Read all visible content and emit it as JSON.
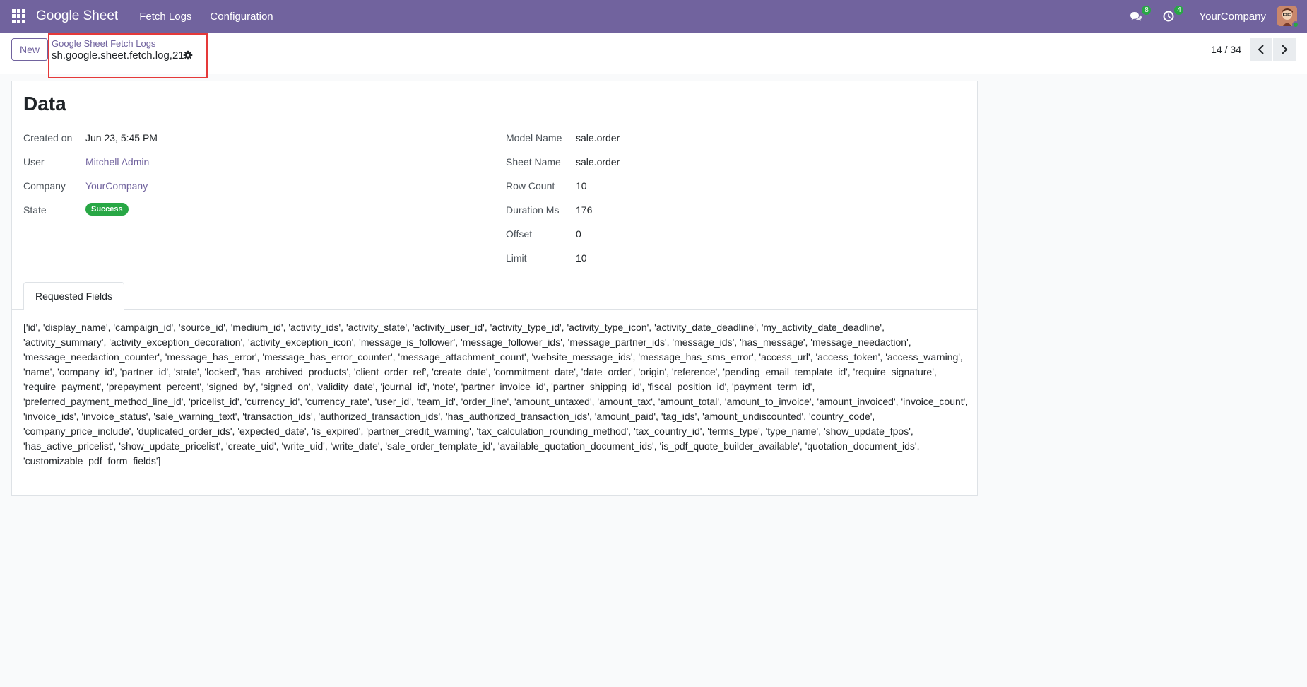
{
  "navbar": {
    "brand": "Google Sheet",
    "menus": [
      "Fetch Logs",
      "Configuration"
    ],
    "messages_count": "8",
    "activities_count": "4",
    "company": "YourCompany"
  },
  "control_panel": {
    "new_label": "New",
    "breadcrumb": "Google Sheet Fetch Logs",
    "record_name": "sh.google.sheet.fetch.log,21",
    "pager": "14 / 34"
  },
  "form": {
    "title": "Data",
    "left_fields": [
      {
        "label": "Created on",
        "value": "Jun 23, 5:45 PM"
      },
      {
        "label": "User",
        "value": "Mitchell Admin"
      },
      {
        "label": "Company",
        "value": "YourCompany"
      },
      {
        "label": "State",
        "value": "Success"
      }
    ],
    "right_fields": [
      {
        "label": "Model Name",
        "value": "sale.order"
      },
      {
        "label": "Sheet Name",
        "value": "sale.order"
      },
      {
        "label": "Row Count",
        "value": "10"
      },
      {
        "label": "Duration Ms",
        "value": "176"
      },
      {
        "label": "Offset",
        "value": "0"
      },
      {
        "label": "Limit",
        "value": "10"
      }
    ],
    "tab_label": "Requested Fields",
    "requested_fields": "['id', 'display_name', 'campaign_id', 'source_id', 'medium_id', 'activity_ids', 'activity_state', 'activity_user_id', 'activity_type_id', 'activity_type_icon', 'activity_date_deadline', 'my_activity_date_deadline', 'activity_summary', 'activity_exception_decoration', 'activity_exception_icon', 'message_is_follower', 'message_follower_ids', 'message_partner_ids', 'message_ids', 'has_message', 'message_needaction', 'message_needaction_counter', 'message_has_error', 'message_has_error_counter', 'message_attachment_count', 'website_message_ids', 'message_has_sms_error', 'access_url', 'access_token', 'access_warning', 'name', 'company_id', 'partner_id', 'state', 'locked', 'has_archived_products', 'client_order_ref', 'create_date', 'commitment_date', 'date_order', 'origin', 'reference', 'pending_email_template_id', 'require_signature', 'require_payment', 'prepayment_percent', 'signed_by', 'signed_on', 'validity_date', 'journal_id', 'note', 'partner_invoice_id', 'partner_shipping_id', 'fiscal_position_id', 'payment_term_id', 'preferred_payment_method_line_id', 'pricelist_id', 'currency_id', 'currency_rate', 'user_id', 'team_id', 'order_line', 'amount_untaxed', 'amount_tax', 'amount_total', 'amount_to_invoice', 'amount_invoiced', 'invoice_count', 'invoice_ids', 'invoice_status', 'sale_warning_text', 'transaction_ids', 'authorized_transaction_ids', 'has_authorized_transaction_ids', 'amount_paid', 'tag_ids', 'amount_undiscounted', 'country_code', 'company_price_include', 'duplicated_order_ids', 'expected_date', 'is_expired', 'partner_credit_warning', 'tax_calculation_rounding_method', 'tax_country_id', 'terms_type', 'type_name', 'show_update_fpos', 'has_active_pricelist', 'show_update_pricelist', 'create_uid', 'write_uid', 'write_date', 'sale_order_template_id', 'available_quotation_document_ids', 'is_pdf_quote_builder_available', 'quotation_document_ids', 'customizable_pdf_form_fields']"
  },
  "colors": {
    "navbar": "#71639e",
    "link": "#71639e",
    "success": "#28a745",
    "highlight_box": "#e53939"
  }
}
